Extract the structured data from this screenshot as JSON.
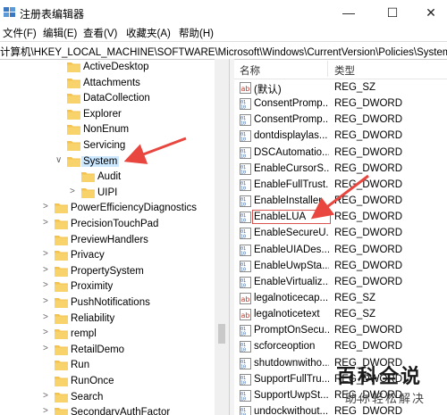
{
  "window": {
    "title": "注册表编辑器",
    "minimize": "—",
    "maximize": "☐",
    "close": "✕"
  },
  "menu": [
    "文件(F)",
    "编辑(E)",
    "查看(V)",
    "收藏夹(A)",
    "帮助(H)"
  ],
  "address": "计算机\\HKEY_LOCAL_MACHINE\\SOFTWARE\\Microsoft\\Windows\\CurrentVersion\\Policies\\System",
  "tree": [
    {
      "label": "ActiveDesktop",
      "expander": "",
      "level": 1
    },
    {
      "label": "Attachments",
      "expander": "",
      "level": 1
    },
    {
      "label": "DataCollection",
      "expander": "",
      "level": 1
    },
    {
      "label": "Explorer",
      "expander": "",
      "level": 1
    },
    {
      "label": "NonEnum",
      "expander": "",
      "level": 1
    },
    {
      "label": "Servicing",
      "expander": "",
      "level": 1
    },
    {
      "label": "System",
      "expander": "∨",
      "level": 1,
      "selected": true
    },
    {
      "label": "Audit",
      "expander": "",
      "level": 2
    },
    {
      "label": "UIPI",
      "expander": ">",
      "level": 2
    },
    {
      "label": "PowerEfficiencyDiagnostics",
      "expander": ">",
      "level": 0
    },
    {
      "label": "PrecisionTouchPad",
      "expander": ">",
      "level": 0
    },
    {
      "label": "PreviewHandlers",
      "expander": "",
      "level": 0
    },
    {
      "label": "Privacy",
      "expander": ">",
      "level": 0
    },
    {
      "label": "PropertySystem",
      "expander": ">",
      "level": 0
    },
    {
      "label": "Proximity",
      "expander": ">",
      "level": 0
    },
    {
      "label": "PushNotifications",
      "expander": ">",
      "level": 0
    },
    {
      "label": "Reliability",
      "expander": ">",
      "level": 0
    },
    {
      "label": "rempl",
      "expander": ">",
      "level": 0
    },
    {
      "label": "RetailDemo",
      "expander": ">",
      "level": 0
    },
    {
      "label": "Run",
      "expander": "",
      "level": 0
    },
    {
      "label": "RunOnce",
      "expander": "",
      "level": 0
    },
    {
      "label": "Search",
      "expander": ">",
      "level": 0
    },
    {
      "label": "SecondaryAuthFactor",
      "expander": ">",
      "level": 0
    }
  ],
  "list": {
    "header_name": "名称",
    "header_type": "类型",
    "rows": [
      {
        "name": "(默认)",
        "type": "REG_SZ",
        "icon": "string-value-icon"
      },
      {
        "name": "ConsentPromp...",
        "type": "REG_DWORD",
        "icon": "dword-value-icon"
      },
      {
        "name": "ConsentPromp...",
        "type": "REG_DWORD",
        "icon": "dword-value-icon"
      },
      {
        "name": "dontdisplaylas...",
        "type": "REG_DWORD",
        "icon": "dword-value-icon"
      },
      {
        "name": "DSCAutomatio...",
        "type": "REG_DWORD",
        "icon": "dword-value-icon"
      },
      {
        "name": "EnableCursorS...",
        "type": "REG_DWORD",
        "icon": "dword-value-icon"
      },
      {
        "name": "EnableFullTrust...",
        "type": "REG_DWORD",
        "icon": "dword-value-icon"
      },
      {
        "name": "EnableInstaller",
        "type": "REG_DWORD",
        "icon": "dword-value-icon"
      },
      {
        "name": "EnableLUA",
        "type": "REG_DWORD",
        "icon": "dword-value-icon",
        "highlight": true
      },
      {
        "name": "EnableSecureU...",
        "type": "REG_DWORD",
        "icon": "dword-value-icon"
      },
      {
        "name": "EnableUIADes...",
        "type": "REG_DWORD",
        "icon": "dword-value-icon"
      },
      {
        "name": "EnableUwpSta...",
        "type": "REG_DWORD",
        "icon": "dword-value-icon"
      },
      {
        "name": "EnableVirtualiz...",
        "type": "REG_DWORD",
        "icon": "dword-value-icon"
      },
      {
        "name": "legalnoticecap...",
        "type": "REG_SZ",
        "icon": "string-value-icon"
      },
      {
        "name": "legalnoticetext",
        "type": "REG_SZ",
        "icon": "string-value-icon"
      },
      {
        "name": "PromptOnSecu...",
        "type": "REG_DWORD",
        "icon": "dword-value-icon"
      },
      {
        "name": "scforceoption",
        "type": "REG_DWORD",
        "icon": "dword-value-icon"
      },
      {
        "name": "shutdownwitho...",
        "type": "REG_DWORD",
        "icon": "dword-value-icon"
      },
      {
        "name": "SupportFullTru...",
        "type": "REG_DWORD",
        "icon": "dword-value-icon"
      },
      {
        "name": "SupportUwpSt...",
        "type": "REG_DWORD",
        "icon": "dword-value-icon"
      },
      {
        "name": "undockwithout...",
        "type": "REG_DWORD",
        "icon": "dword-value-icon"
      }
    ]
  },
  "watermark": {
    "big": "百科全说",
    "small": "助你轻松解决"
  },
  "colors": {
    "annotation": "#e8463f",
    "folder": "#f3c24f",
    "selection": "#cce8ff"
  }
}
